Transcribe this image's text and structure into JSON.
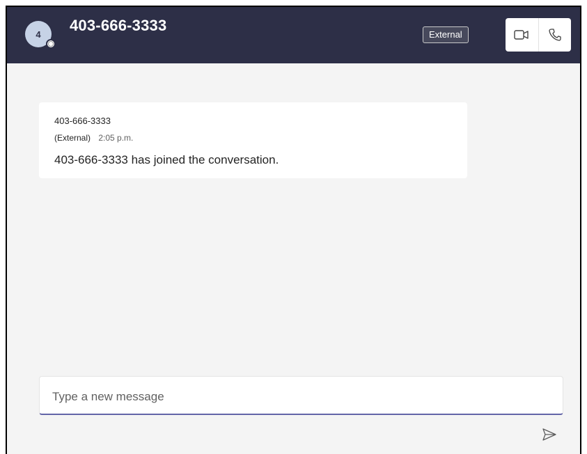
{
  "header": {
    "avatar_initial": "4",
    "title": "403-666-3333",
    "external_badge": "External",
    "video_call_icon": "video-camera-icon",
    "audio_call_icon": "phone-icon"
  },
  "messages": [
    {
      "sender": "403-666-3333",
      "external_label": "(External)",
      "time": "2:05 p.m.",
      "text": "403-666-3333 has joined the conversation."
    }
  ],
  "compose": {
    "placeholder": "Type a new message",
    "send_icon": "send-icon"
  },
  "colors": {
    "header_bg": "#2d2f47",
    "accent": "#6264a7",
    "chat_bg": "#f4f4f4"
  }
}
